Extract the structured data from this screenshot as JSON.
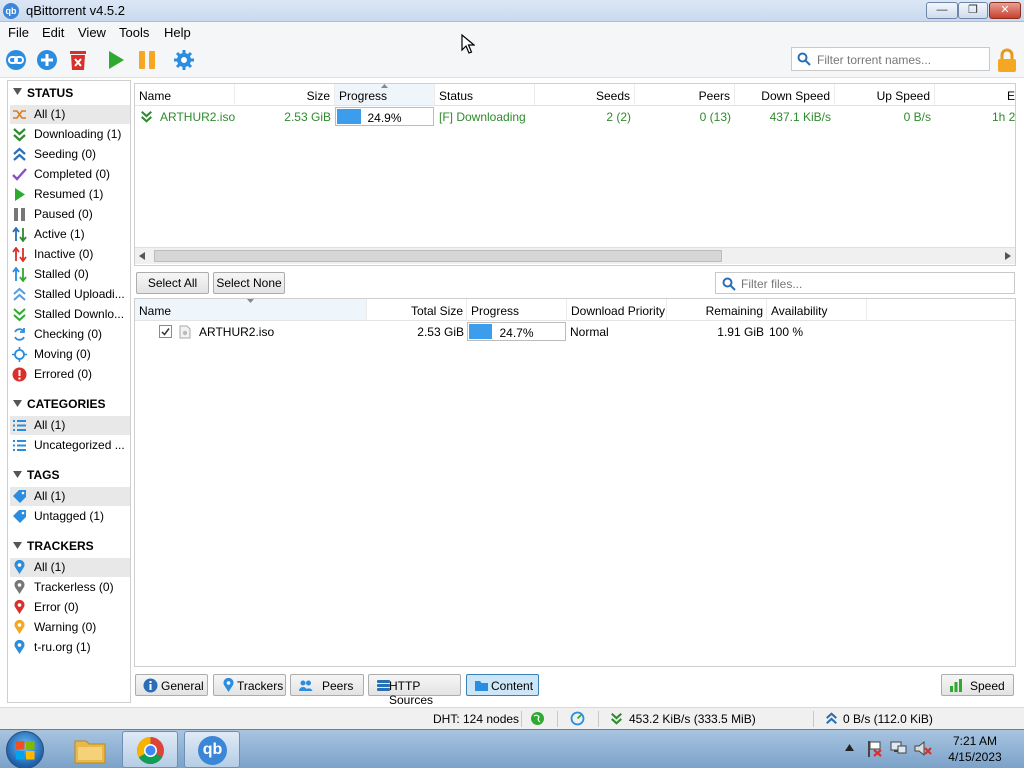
{
  "window": {
    "title": "qBittorrent v4.5.2",
    "app_icon_text": "qb"
  },
  "menu": [
    "File",
    "Edit",
    "View",
    "Tools",
    "Help"
  ],
  "search": {
    "placeholder": "Filter torrent names..."
  },
  "sidebar": {
    "status": {
      "title": "STATUS",
      "items": [
        {
          "label": "All (1)",
          "icon": "shuffle-icon"
        },
        {
          "label": "Downloading (1)",
          "icon": "download-icon"
        },
        {
          "label": "Seeding (0)",
          "icon": "upload-icon"
        },
        {
          "label": "Completed (0)",
          "icon": "checkmark-icon"
        },
        {
          "label": "Resumed (1)",
          "icon": "play-icon"
        },
        {
          "label": "Paused (0)",
          "icon": "pause-icon"
        },
        {
          "label": "Active (1)",
          "icon": "updown-arrows-icon"
        },
        {
          "label": "Inactive (0)",
          "icon": "updown-arrows-red-icon"
        },
        {
          "label": "Stalled (0)",
          "icon": "stalled-icon"
        },
        {
          "label": "Stalled Uploadi...",
          "icon": "stalled-upload-icon"
        },
        {
          "label": "Stalled Downlo...",
          "icon": "stalled-download-icon"
        },
        {
          "label": "Checking (0)",
          "icon": "checking-icon"
        },
        {
          "label": "Moving (0)",
          "icon": "moving-icon"
        },
        {
          "label": "Errored (0)",
          "icon": "error-icon"
        }
      ]
    },
    "categories": {
      "title": "CATEGORIES",
      "items": [
        "All (1)",
        "Uncategorized ..."
      ]
    },
    "tags": {
      "title": "TAGS",
      "items": [
        "All (1)",
        "Untagged (1)"
      ]
    },
    "trackers": {
      "title": "TRACKERS",
      "items": [
        "All (1)",
        "Trackerless (0)",
        "Error (0)",
        "Warning (0)",
        "t-ru.org (1)"
      ]
    }
  },
  "torrent_table": {
    "columns": [
      "Name",
      "Size",
      "Progress",
      "Status",
      "Seeds",
      "Peers",
      "Down Speed",
      "Up Speed",
      "E"
    ],
    "rows": [
      {
        "name": "ARTHUR2.iso",
        "size": "2.53 GiB",
        "progress": 24.9,
        "progress_text": "24.9%",
        "status": "[F] Downloading",
        "seeds": "2 (2)",
        "peers": "0 (13)",
        "down_speed": "437.1 KiB/s",
        "up_speed": "0 B/s",
        "eta": "1h 2"
      }
    ]
  },
  "content": {
    "select_all": "Select All",
    "select_none": "Select None",
    "filter_placeholder": "Filter files...",
    "columns": [
      "Name",
      "Total Size",
      "Progress",
      "Download Priority",
      "Remaining",
      "Availability"
    ],
    "rows": [
      {
        "name": "ARTHUR2.iso",
        "checked": true,
        "total_size": "2.53 GiB",
        "progress": 24.7,
        "progress_text": "24.7%",
        "priority": "Normal",
        "remaining": "1.91 GiB",
        "availability": "100 %"
      }
    ]
  },
  "tabs": [
    "General",
    "Trackers",
    "Peers",
    "HTTP Sources",
    "Content"
  ],
  "selected_tab": "Content",
  "speed_button": "Speed",
  "statusbar": {
    "dht": "DHT: 124 nodes",
    "download": "453.2 KiB/s (333.5 MiB)",
    "upload": "0 B/s (112.0 KiB)"
  },
  "taskbar": {
    "time": "7:21 AM",
    "date": "4/15/2023",
    "qb_label": "qb"
  },
  "colors": {
    "accent_blue": "#3d9ded",
    "green_text": "#2e8b2e",
    "selection": "#e8e8e8",
    "tab_selected": "#cde6f7"
  }
}
